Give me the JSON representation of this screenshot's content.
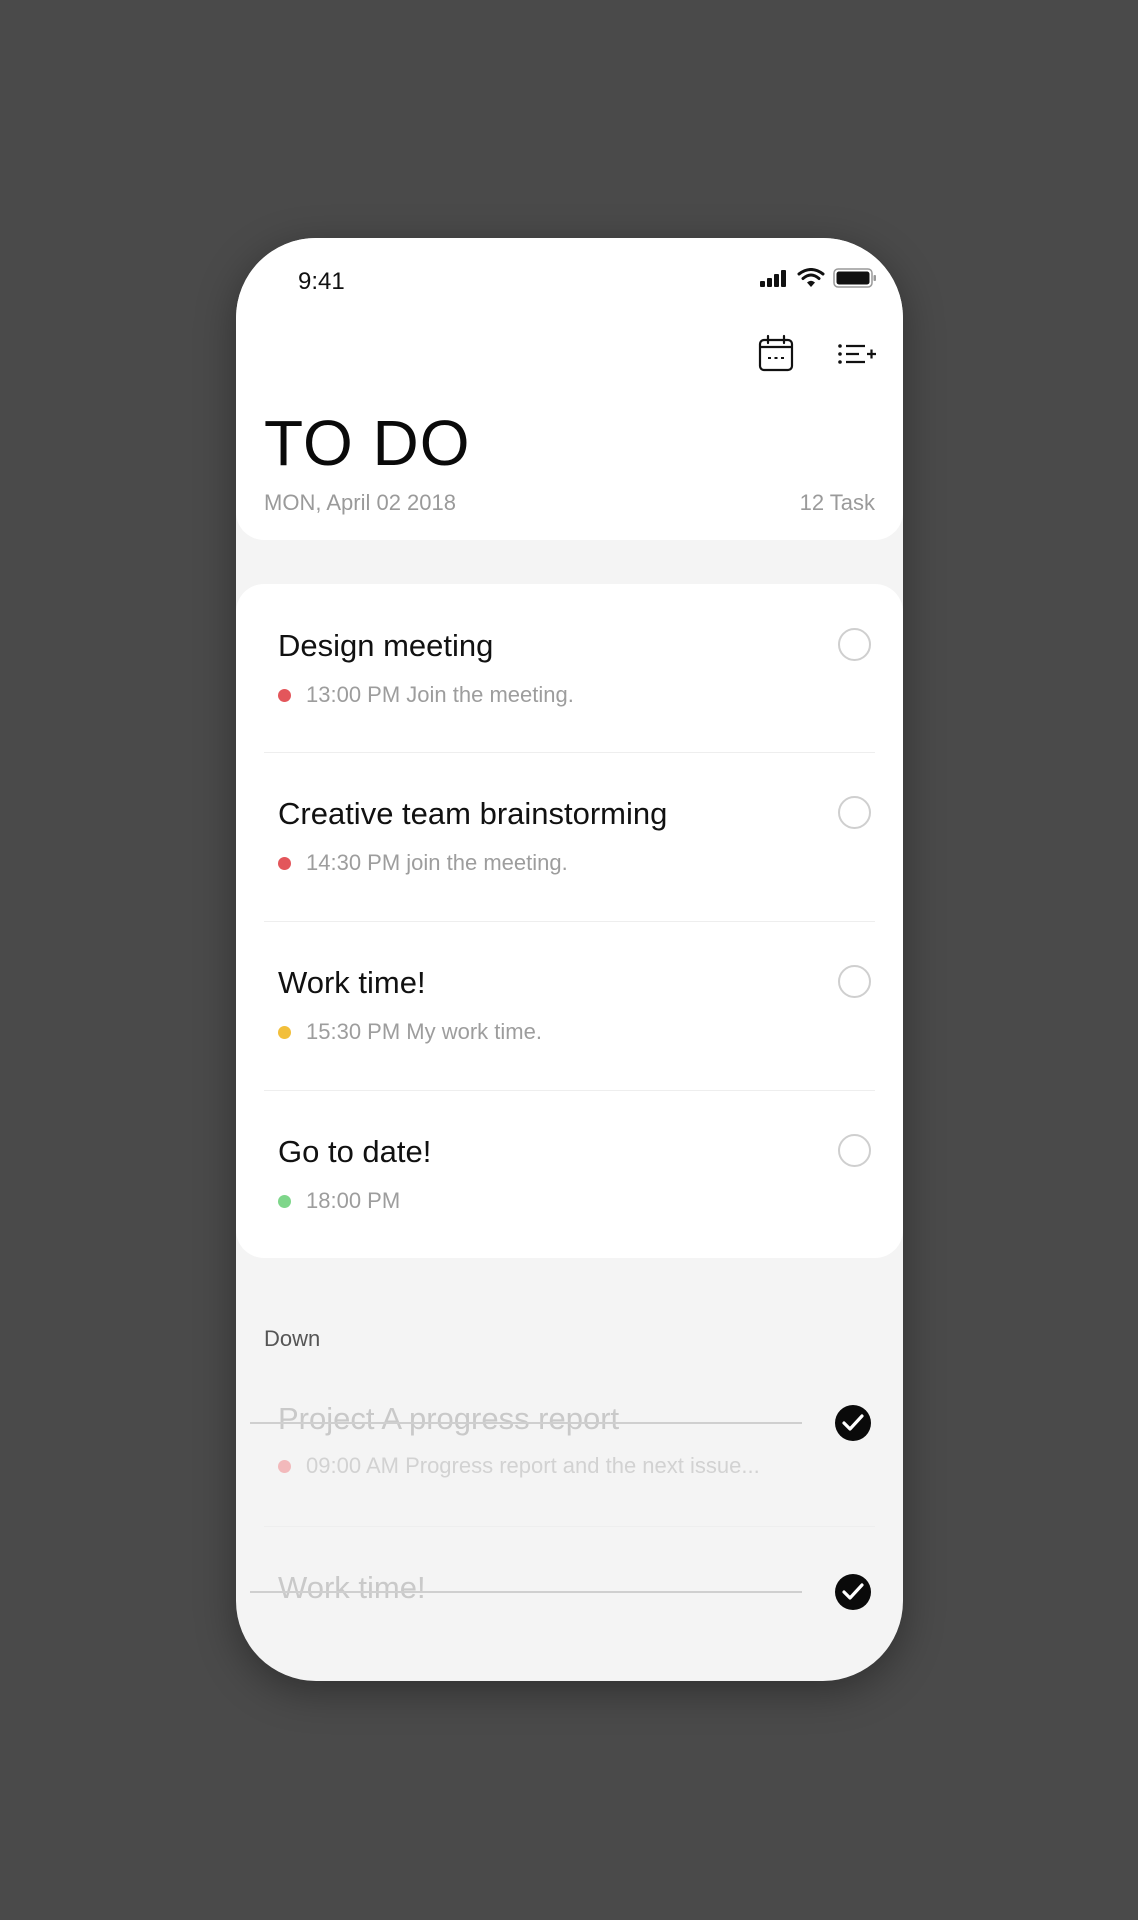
{
  "status_bar": {
    "time": "9:41"
  },
  "toolbar": {
    "icons": [
      "calendar-icon",
      "add-list-icon"
    ]
  },
  "header": {
    "title": "TO DO",
    "date": "MON, April 02 2018",
    "task_count": "12 Task"
  },
  "tasks": [
    {
      "title": "Design meeting",
      "subtitle": "13:00 PM Join the meeting.",
      "dot_color": "#e3565b"
    },
    {
      "title": "Creative team brainstorming",
      "subtitle": "14:30 PM join the meeting.",
      "dot_color": "#e3565b"
    },
    {
      "title": "Work time!",
      "subtitle": "15:30 PM My work time.",
      "dot_color": "#f2bf3b"
    },
    {
      "title": "Go to date!",
      "subtitle": "18:00 PM",
      "dot_color": "#7ed68a"
    }
  ],
  "done_section": {
    "label": "Down",
    "items": [
      {
        "title": "Project A progress report",
        "subtitle": "09:00 AM Progress report and the next issue...",
        "dot_color": "#f2b9bb"
      },
      {
        "title": "Work time!",
        "subtitle": ""
      }
    ]
  }
}
